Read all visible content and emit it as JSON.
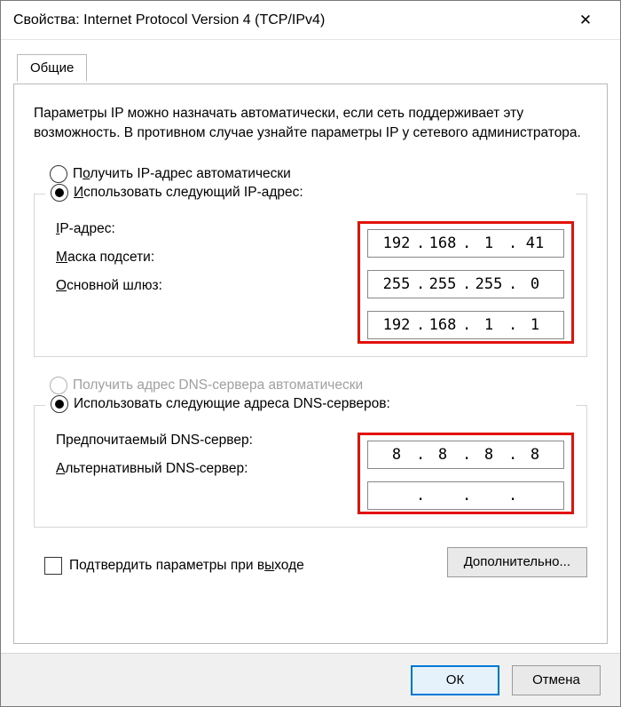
{
  "title": "Свойства: Internet Protocol Version 4 (TCP/IPv4)",
  "tab": "Общие",
  "description": "Параметры IP можно назначать автоматически, если сеть поддерживает эту возможность. В противном случае узнайте параметры IP у сетевого администратора.",
  "ip_section": {
    "auto_label_pre": "П",
    "auto_label_ul": "о",
    "auto_label_post": "лучить IP-адрес автоматически",
    "manual_label_pre": "",
    "manual_label_ul": "И",
    "manual_label_post": "спользовать следующий IP-адрес:",
    "fields": {
      "ip": {
        "label_pre": "",
        "label_ul": "I",
        "label_post": "P-адрес:",
        "o1": "192",
        "o2": "168",
        "o3": "1",
        "o4": "41"
      },
      "mask": {
        "label_pre": "",
        "label_ul": "М",
        "label_post": "аска подсети:",
        "o1": "255",
        "o2": "255",
        "o3": "255",
        "o4": "0"
      },
      "gw": {
        "label_pre": "",
        "label_ul": "О",
        "label_post": "сновной шлюз:",
        "o1": "192",
        "o2": "168",
        "o3": "1",
        "o4": "1"
      }
    }
  },
  "dns_section": {
    "auto_label_pre": "Получить адрес DNS-сервера автоматически",
    "manual_label_pre": "Использовать следующие адреса DNS-серверов:",
    "fields": {
      "pref": {
        "label_pre": "Предпочитаемый DNS-сервер:",
        "o1": "8",
        "o2": "8",
        "o3": "8",
        "o4": "8"
      },
      "alt": {
        "label_pre": "",
        "label_ul": "А",
        "label_post": "льтернативный DNS-сервер:",
        "o1": "",
        "o2": "",
        "o3": "",
        "o4": ""
      }
    }
  },
  "validate_label_pre": "Подтвердить параметры при в",
  "validate_label_ul": "ы",
  "validate_label_post": "ходе",
  "advanced_label_pre": "",
  "advanced_label_ul": "Д",
  "advanced_label_post": "ополнительно...",
  "ok": "ОК",
  "cancel": "Отмена"
}
